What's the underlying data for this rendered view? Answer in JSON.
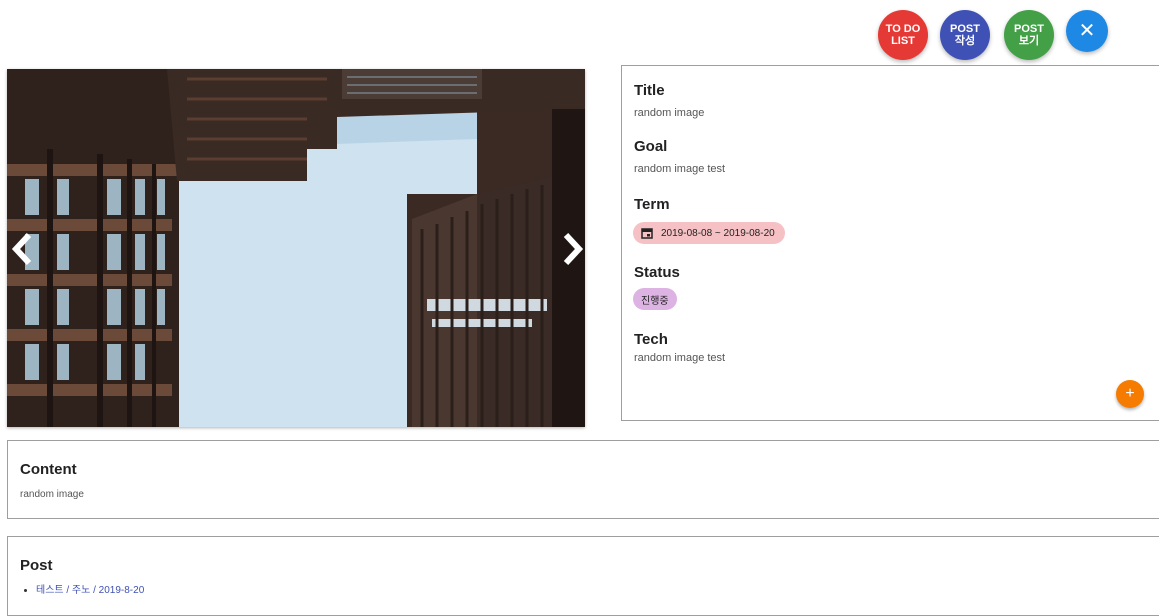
{
  "fabs": {
    "todo_label": "TO DO\nLIST",
    "post_write_label": "POST\n작성",
    "post_view_label": "POST\n보기",
    "close_label": "✕",
    "colors": {
      "todo": "#e53935",
      "post_write": "#3f51b5",
      "post_view": "#43a047",
      "close": "#1e88e5"
    }
  },
  "carousel": {
    "prev_icon": "chevron-left-icon",
    "next_icon": "chevron-right-icon"
  },
  "info": {
    "title_heading": "Title",
    "title_value": "random image",
    "goal_heading": "Goal",
    "goal_value": "random image test",
    "term_heading": "Term",
    "term_value": "2019-08-08 ~ 2019-08-20",
    "term_icon": "calendar-icon",
    "status_heading": "Status",
    "status_value": "진행중",
    "tech_heading": "Tech",
    "tech_value": "random image test",
    "add_label": "+"
  },
  "content": {
    "heading": "Content",
    "text": "random image"
  },
  "post": {
    "heading": "Post",
    "items": [
      {
        "label": "테스트 / 주노 / 2019-8-20"
      }
    ]
  }
}
